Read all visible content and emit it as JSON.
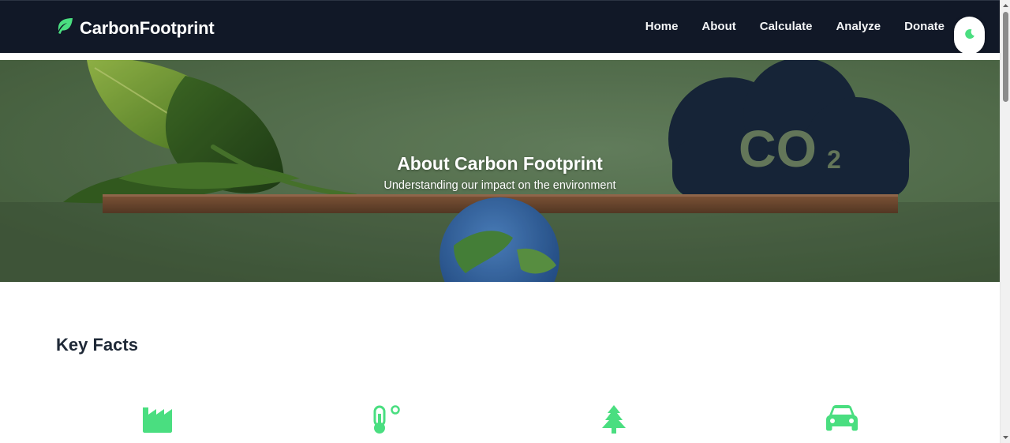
{
  "brand": {
    "name": "CarbonFootprint",
    "icon": "leaf-icon"
  },
  "nav": {
    "links": [
      "Home",
      "About",
      "Calculate",
      "Analyze",
      "Donate"
    ],
    "theme_toggle_icon": "moon-icon"
  },
  "hero": {
    "title": "About Carbon Footprint",
    "subtitle": "Understanding our impact on the environment",
    "cloud_text": "CO",
    "cloud_subscript": "2"
  },
  "key_facts": {
    "title": "Key Facts",
    "icons": [
      "factory-icon",
      "thermometer-icon",
      "tree-icon",
      "car-icon"
    ]
  },
  "colors": {
    "nav_bg": "#111827",
    "accent_green": "#4ade80",
    "text_dark": "#1f2937"
  }
}
